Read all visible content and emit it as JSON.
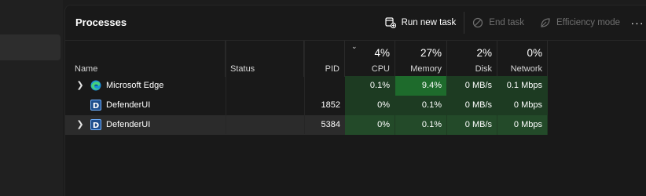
{
  "page": {
    "title": "Processes"
  },
  "toolbar": {
    "run_new_task": "Run new task",
    "end_task": "End task",
    "efficiency_mode": "Efficiency mode",
    "more": "···"
  },
  "columns": {
    "name": "Name",
    "status": "Status",
    "pid": "PID",
    "cpu": {
      "label": "CPU",
      "percent": "4%"
    },
    "memory": {
      "label": "Memory",
      "percent": "27%"
    },
    "disk": {
      "label": "Disk",
      "percent": "2%"
    },
    "network": {
      "label": "Network",
      "percent": "0%"
    }
  },
  "rows": [
    {
      "expandable": true,
      "icon": "edge-icon",
      "name": "Microsoft Edge",
      "status": "",
      "pid": "",
      "cpu": "0.1%",
      "memory": "9.4%",
      "disk": "0 MB/s",
      "network": "0.1 Mbps"
    },
    {
      "expandable": false,
      "icon": "defender-icon",
      "name": "DefenderUI",
      "status": "",
      "pid": "1852",
      "cpu": "0%",
      "memory": "0.1%",
      "disk": "0 MB/s",
      "network": "0 Mbps"
    },
    {
      "expandable": true,
      "icon": "defender-icon",
      "name": "DefenderUI",
      "status": "",
      "pid": "5384",
      "cpu": "0%",
      "memory": "0.1%",
      "disk": "0 MB/s",
      "network": "0 Mbps"
    }
  ],
  "colors": {
    "heat_low": "#1d3b22",
    "heat_mid": "#234a29",
    "heat_high": "#1e6b2c",
    "accent": "#4cc2ff"
  }
}
